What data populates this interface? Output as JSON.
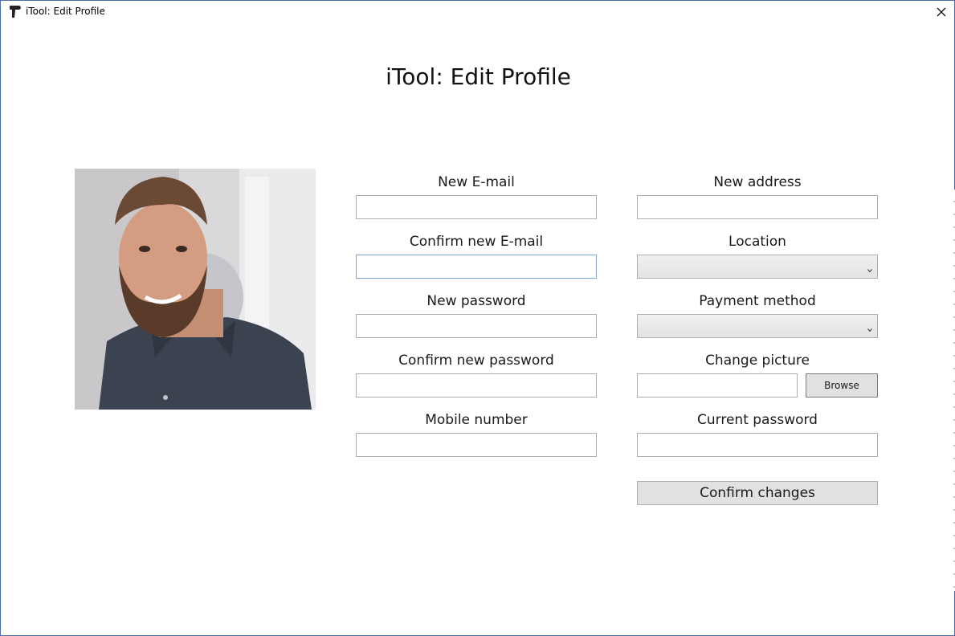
{
  "window": {
    "title": "iTool: Edit Profile",
    "app_icon": "itool-drill-icon",
    "close_icon": "close-icon"
  },
  "page": {
    "heading": "iTool: Edit Profile"
  },
  "profile_photo": {
    "description_icon": "profile-photo"
  },
  "left_column": {
    "new_email": {
      "label": "New E-mail",
      "value": ""
    },
    "confirm_email": {
      "label": "Confirm new E-mail",
      "value": ""
    },
    "new_password": {
      "label": "New password",
      "value": ""
    },
    "confirm_password": {
      "label": "Confirm new password",
      "value": ""
    },
    "mobile": {
      "label": "Mobile number",
      "value": ""
    }
  },
  "right_column": {
    "new_address": {
      "label": "New address",
      "value": ""
    },
    "location": {
      "label": "Location",
      "selected": ""
    },
    "payment_method": {
      "label": "Payment method",
      "selected": ""
    },
    "change_picture": {
      "label": "Change picture",
      "value": "",
      "browse_label": "Browse"
    },
    "current_password": {
      "label": "Current password",
      "value": ""
    }
  },
  "actions": {
    "confirm_label": "Confirm changes"
  },
  "colors": {
    "button_bg": "#e1e1e1",
    "input_border": "#adadad",
    "focus_border": "#7aa7d6",
    "window_border": "#4a6fa5"
  }
}
